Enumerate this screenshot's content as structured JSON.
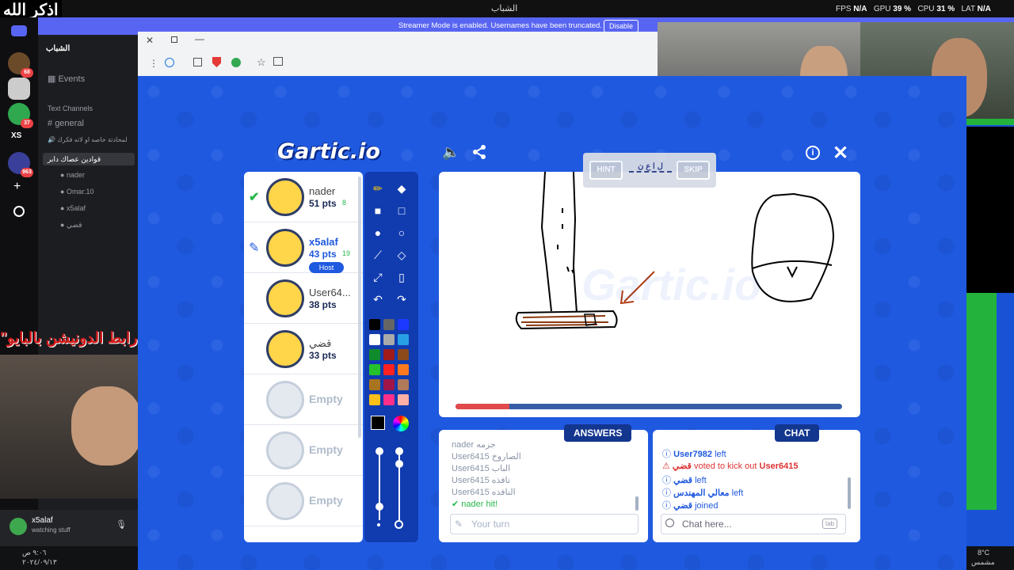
{
  "overlay": {
    "zikr": "اذكر الله",
    "donation": "\"رابط الدونيشن بالبايو\""
  },
  "topbar": {
    "server_title": "الشباب",
    "fps_label": "FPS",
    "fps": "N/A",
    "gpu_label": "GPU",
    "gpu": "39 %",
    "cpu_label": "CPU",
    "cpu": "31 %",
    "lat_label": "LAT",
    "lat": "N/A"
  },
  "streamer": {
    "text": "Streamer Mode is enabled. Usernames have been truncated.",
    "disable": "Disable"
  },
  "servers": [
    {
      "badge": "68"
    },
    {
      "badge": ""
    },
    {
      "badge": "37"
    },
    {
      "badge": "XS"
    },
    {
      "badge": "963"
    }
  ],
  "discord": {
    "server_name": "الشباب",
    "events": "Events",
    "text_channels": "Text Channels",
    "channel_general": "general",
    "channel_2": "لمحادثة خاصه او لاته فكرك",
    "voice_channel": "قوادين عصاك دابر",
    "voice_users": [
      "nader",
      "Omar.10",
      "x5alaf",
      "قضي"
    ],
    "me_name": "x5alaf",
    "me_status": "watching stuff",
    "time": "٩:٠٦ ص",
    "date": "٢٠٢٤/٠٩/١٣"
  },
  "game": {
    "logo": "Gartic.io",
    "players": [
      {
        "name": "nader",
        "pts": "51 pts",
        "badge": "8"
      },
      {
        "name": "x5alaf",
        "pts": "43 pts",
        "badge": "19",
        "host": "Host"
      },
      {
        "name": "User64...",
        "pts": "38 pts"
      },
      {
        "name": "قضي",
        "pts": "33 pts"
      },
      {
        "name": "Empty"
      },
      {
        "name": "Empty"
      },
      {
        "name": "Empty"
      }
    ],
    "hint": {
      "hint_label": "HINT",
      "skip_label": "SKIP",
      "word": "ل ا ع ن"
    },
    "progress": 0.14,
    "answers_title": "ANSWERS",
    "answers": [
      {
        "user": "nader",
        "text": "جزمه"
      },
      {
        "user": "User6415",
        "text": "الصاروخ"
      },
      {
        "user": "User6415",
        "text": "الباب"
      },
      {
        "user": "User6415",
        "text": "تافذه"
      },
      {
        "user": "User6415",
        "text": "النافذه"
      },
      {
        "user": "nader",
        "text": "hit!"
      }
    ],
    "answer_placeholder": "Your turn",
    "chat_title": "CHAT",
    "chat": [
      {
        "user": "User7982",
        "text": "left"
      },
      {
        "user": "قضي",
        "text": "voted to kick out",
        "target": "User6415"
      },
      {
        "user": "قضي",
        "text": "left"
      },
      {
        "user": "معالي المهندس",
        "text": "left"
      },
      {
        "user": "قضي",
        "text": "joined"
      }
    ],
    "chat_placeholder": "Chat here...",
    "chat_tab": "tab"
  },
  "taskbar": {
    "temp": "8°C",
    "weather": "مشمس"
  },
  "colors": {
    "game_blue": "#1f59e0",
    "purple": "#5865f2",
    "green": "#23b33c",
    "host": "#1f59e0"
  },
  "icons": [
    "search-icon",
    "pencil-icon",
    "bucket-icon",
    "square-icon",
    "circle-icon",
    "line-icon",
    "eraser-icon",
    "dropper-icon",
    "speaker-icon",
    "share-icon",
    "info-icon",
    "close-icon"
  ],
  "palette": [
    "#000000",
    "#666666",
    "#1c3aff",
    "#ffffff",
    "#aaaaaa",
    "#27a0e6",
    "#0f8a2c",
    "#a01c1c",
    "#8c4a1c",
    "#26c22b",
    "#ff2020",
    "#ff7a1f",
    "#a87420",
    "#a0154a",
    "#b07a5a",
    "#ffbf1a",
    "#ff2f8a",
    "#ffb0a6"
  ]
}
